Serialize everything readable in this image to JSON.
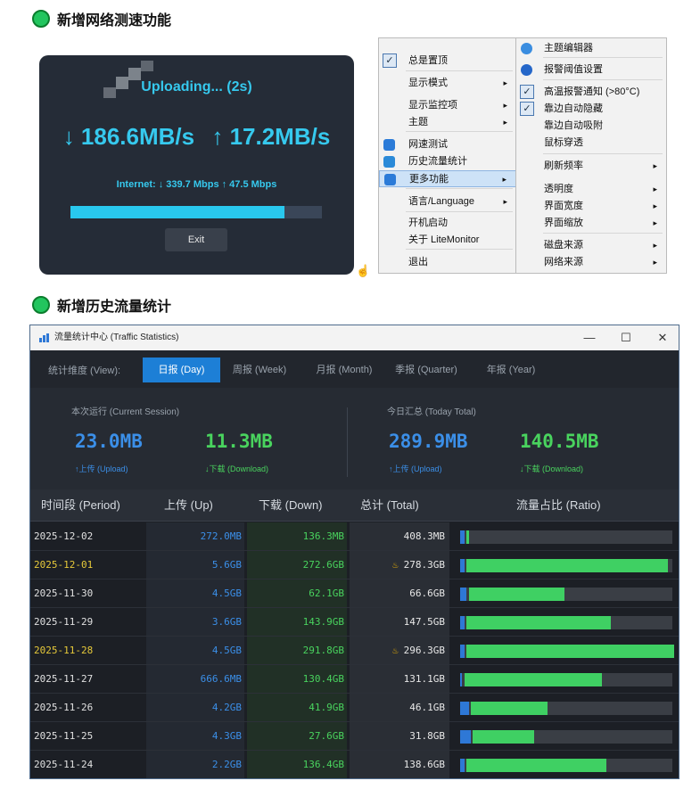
{
  "section1": {
    "title": "新增网络测速功能"
  },
  "section2": {
    "title": "新增历史流量统计"
  },
  "speedtest": {
    "status": "Uploading... (2s)",
    "download": "↓ 186.6MB/s",
    "upload": "↑ 17.2MB/s",
    "internet": "Internet: ↓ 339.7 Mbps  ↑ 47.5 Mbps",
    "progress_fraction": 0.85,
    "exit_label": "Exit"
  },
  "menu_main": {
    "items": [
      {
        "label": "总是置顶",
        "checked": true,
        "arrow": ""
      },
      {
        "label": "显示模式",
        "arrow": "▸"
      },
      {
        "label": "显示监控项",
        "arrow": "▸"
      },
      {
        "label": "主题",
        "arrow": "▸"
      },
      {
        "label": "网速测试",
        "icon": "rocket-icon",
        "arrow": ""
      },
      {
        "label": "历史流量统计",
        "icon": "chart-icon",
        "arrow": ""
      },
      {
        "label": "更多功能",
        "icon": "grid-icon",
        "arrow": "▸",
        "highlighted": true
      },
      {
        "label": "语言/Language",
        "arrow": "▸"
      },
      {
        "label": "开机启动",
        "arrow": ""
      },
      {
        "label": "关于 LiteMonitor",
        "arrow": ""
      },
      {
        "label": "退出",
        "arrow": ""
      }
    ]
  },
  "menu_more": {
    "items": [
      {
        "label": "主题编辑器",
        "icon": "palette-icon",
        "arrow": ""
      },
      {
        "label": "报警阈值设置",
        "icon": "info-icon",
        "arrow": ""
      },
      {
        "label": "高温报警通知 (>80°C)",
        "checked": true,
        "arrow": ""
      },
      {
        "label": "靠边自动隐藏",
        "checked": true,
        "arrow": ""
      },
      {
        "label": "靠边自动吸附",
        "arrow": ""
      },
      {
        "label": "鼠标穿透",
        "arrow": ""
      },
      {
        "label": "刷新频率",
        "arrow": "▸"
      },
      {
        "label": "透明度",
        "arrow": "▸"
      },
      {
        "label": "界面宽度",
        "arrow": "▸"
      },
      {
        "label": "界面缩放",
        "arrow": "▸"
      },
      {
        "label": "磁盘来源",
        "arrow": "▸"
      },
      {
        "label": "网络来源",
        "arrow": "▸"
      }
    ]
  },
  "traffic": {
    "window_title": "流量统计中心 (Traffic Statistics)",
    "controls": {
      "minimize": "—",
      "maximize": "☐",
      "close": "✕"
    },
    "view_label": "统计维度 (View):",
    "tabs": [
      {
        "label": "日报 (Day)",
        "active": true
      },
      {
        "label": "周报 (Week)"
      },
      {
        "label": "月报 (Month)"
      },
      {
        "label": "季报 (Quarter)"
      },
      {
        "label": "年报 (Year)"
      }
    ],
    "session": {
      "label": "本次运行 (Current Session)",
      "upload": "23.0MB",
      "upload_label": "↑上传 (Upload)",
      "download": "11.3MB",
      "download_label": "↓下载 (Download)"
    },
    "today": {
      "label": "今日汇总 (Today Total)",
      "upload": "289.9MB",
      "upload_label": "↑上传 (Upload)",
      "download": "140.5MB",
      "download_label": "↓下载 (Download)"
    },
    "columns": [
      "时间段 (Period)",
      "上传 (Up)",
      "下载 (Down)",
      "总计 (Total)",
      "流量占比 (Ratio)"
    ],
    "rows": [
      {
        "period": "2025-12-02",
        "up": "272.0MB",
        "down": "136.3MB",
        "total": "408.3MB",
        "peak": false,
        "up_frac": 0.02,
        "down_frac": 0.01
      },
      {
        "period": "2025-12-01",
        "up": "5.6GB",
        "down": "272.6GB",
        "total": "278.3GB",
        "peak": true,
        "up_frac": 0.02,
        "down_frac": 0.95
      },
      {
        "period": "2025-11-30",
        "up": "4.5GB",
        "down": "62.1GB",
        "total": "66.6GB",
        "peak": false,
        "up_frac": 0.03,
        "down_frac": 0.45
      },
      {
        "period": "2025-11-29",
        "up": "3.6GB",
        "down": "143.9GB",
        "total": "147.5GB",
        "peak": false,
        "up_frac": 0.02,
        "down_frac": 0.68
      },
      {
        "period": "2025-11-28",
        "up": "4.5GB",
        "down": "291.8GB",
        "total": "296.3GB",
        "peak": true,
        "up_frac": 0.02,
        "down_frac": 0.98
      },
      {
        "period": "2025-11-27",
        "up": "666.6MB",
        "down": "130.4GB",
        "total": "131.1GB",
        "peak": false,
        "up_frac": 0.01,
        "down_frac": 0.65
      },
      {
        "period": "2025-11-26",
        "up": "4.2GB",
        "down": "41.9GB",
        "total": "46.1GB",
        "peak": false,
        "up_frac": 0.04,
        "down_frac": 0.36
      },
      {
        "period": "2025-11-25",
        "up": "4.3GB",
        "down": "27.6GB",
        "total": "31.8GB",
        "peak": false,
        "up_frac": 0.05,
        "down_frac": 0.29
      },
      {
        "period": "2025-11-24",
        "up": "2.2GB",
        "down": "136.4GB",
        "total": "138.6GB",
        "peak": false,
        "up_frac": 0.02,
        "down_frac": 0.66
      }
    ]
  }
}
